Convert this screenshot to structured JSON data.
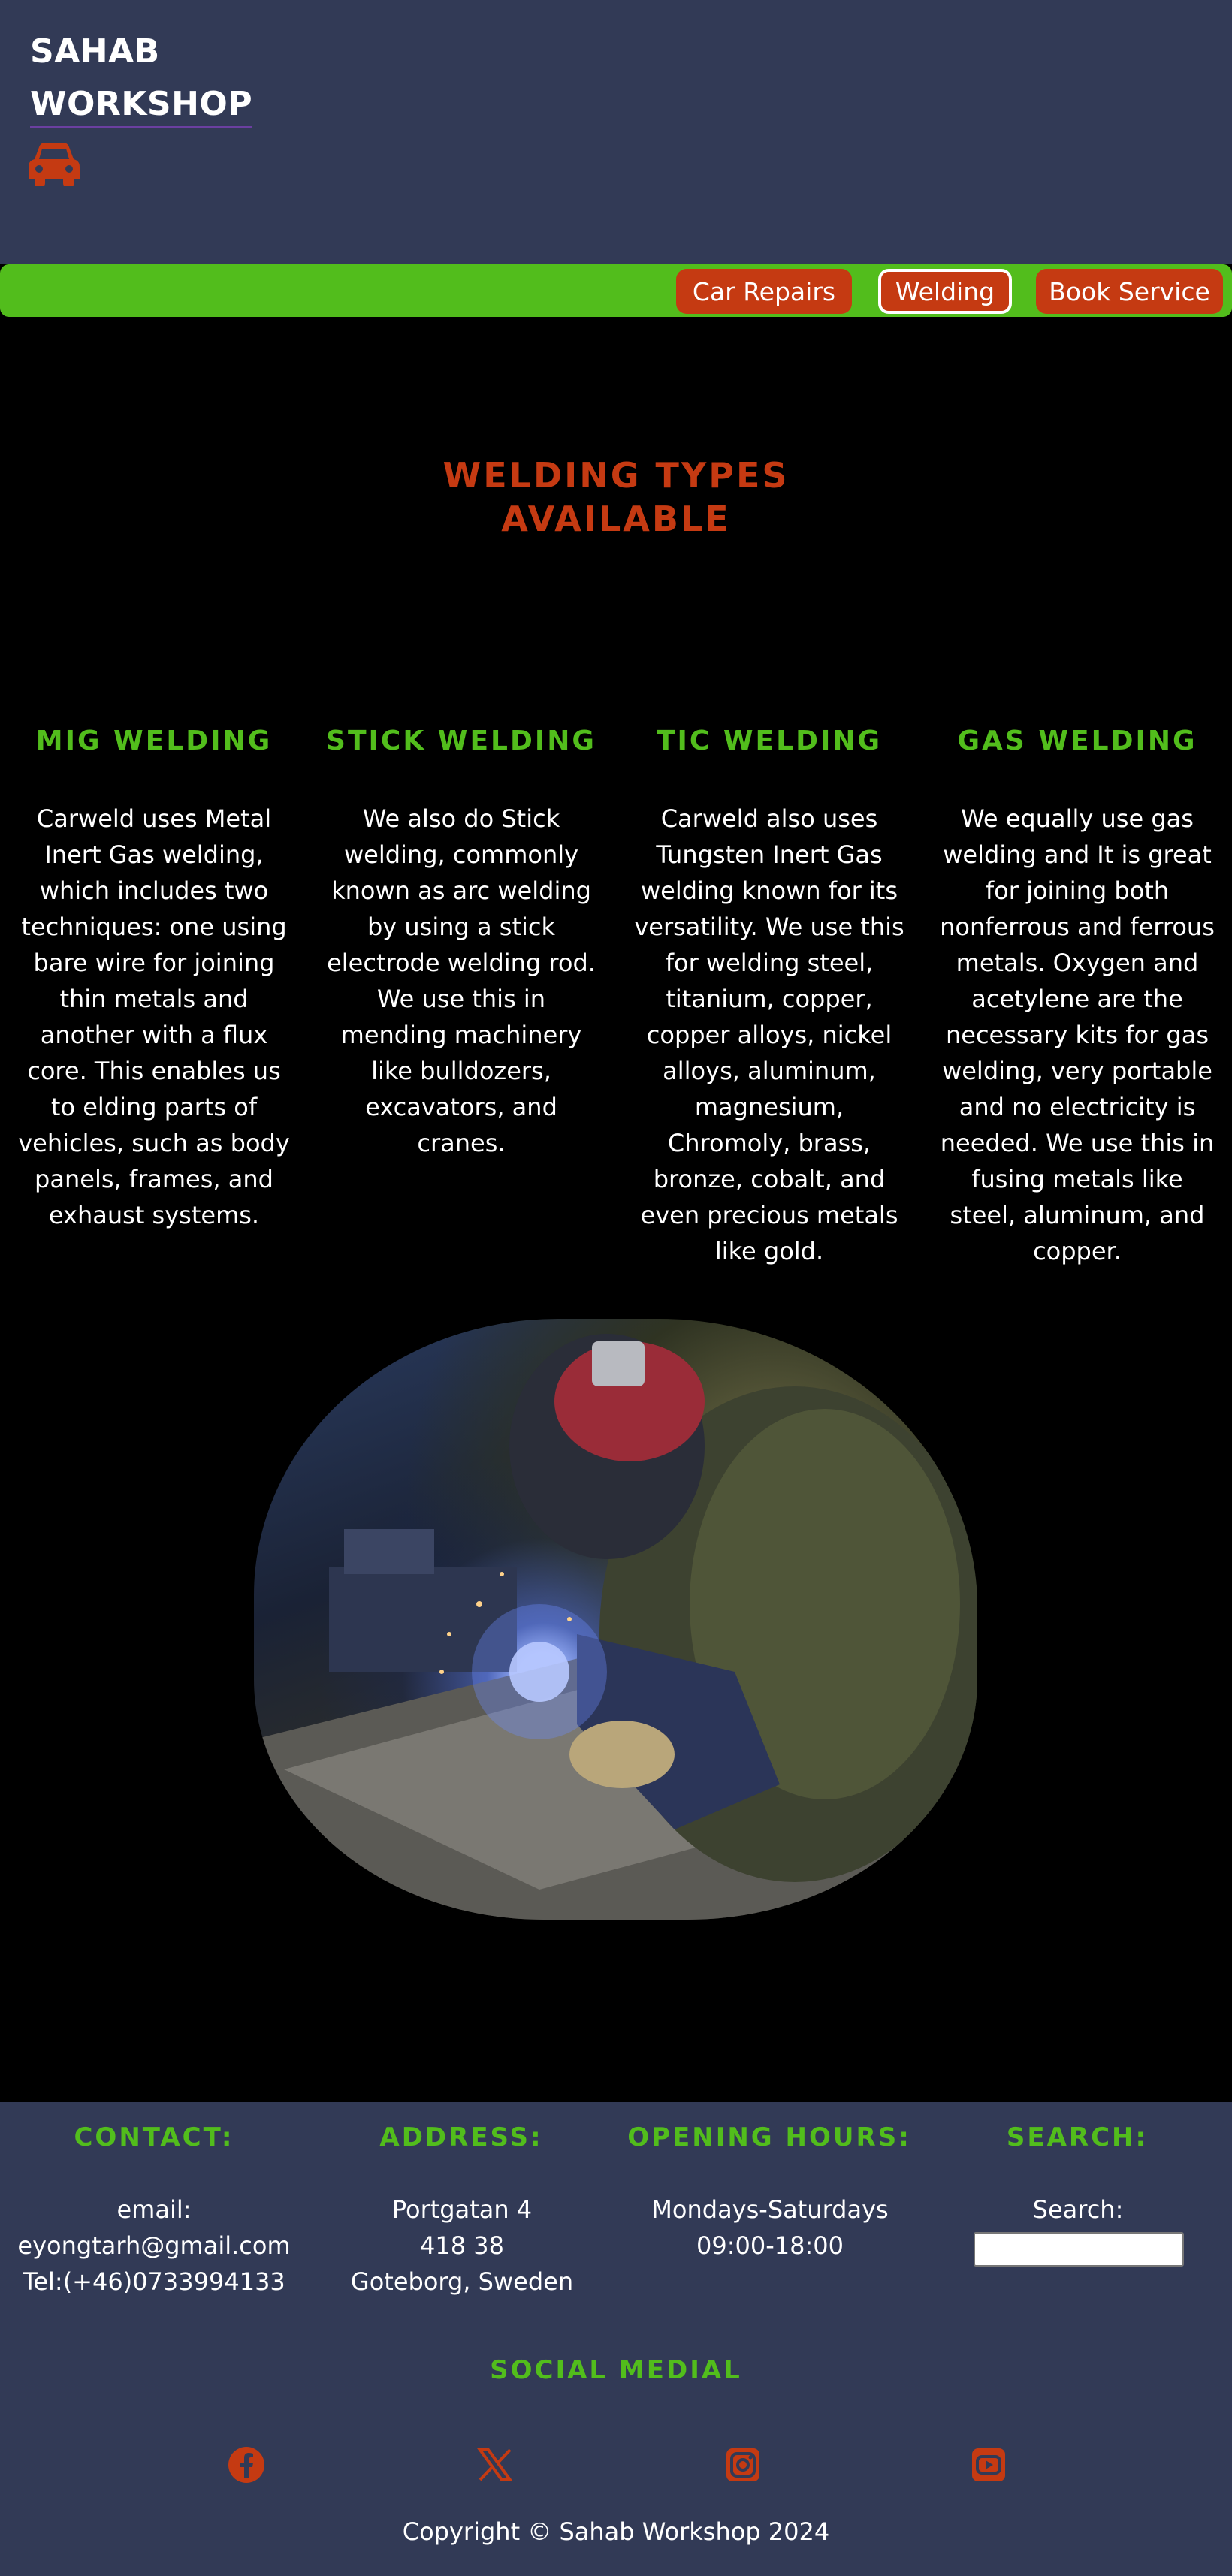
{
  "brand": {
    "line1": "SAHAB",
    "line2": "WORKSHOP",
    "icon": "car-icon"
  },
  "nav": {
    "items": [
      "Car Repairs",
      "Welding",
      "Book Service"
    ],
    "active": "Welding"
  },
  "main": {
    "title_line1": "WELDING TYPES",
    "title_line2": "AVAILABLE",
    "columns": [
      {
        "title": "MIG WELDING",
        "text": "Carweld uses Metal Inert Gas welding, which includes two techniques: one using bare wire for joining thin metals and another with a flux core. This enables us to elding parts of vehicles, such as body panels, frames, and exhaust systems."
      },
      {
        "title": "STICK WELDING",
        "text": "We also do Stick welding, commonly known as arc welding by using a stick electrode welding rod. We use this in mending machinery like bulldozers, excavators, and cranes."
      },
      {
        "title": "TIC WELDING",
        "text": "Carweld also uses Tungsten Inert Gas welding known for its versatility. We use this for welding steel, titanium, copper, copper alloys, nickel alloys, aluminum, magnesium, Chromoly, brass, bronze, cobalt, and even precious metals like gold."
      },
      {
        "title": "GAS WELDING",
        "text": "We equally use gas welding and It is great for joining both nonferrous and ferrous metals. Oxygen and acetylene are the necessary kits for gas welding, very portable and no electricity is needed. We use this in fusing metals like steel, aluminum, and copper."
      }
    ]
  },
  "footer": {
    "contact": {
      "title": "CONTACT:",
      "email_label": "email:",
      "email": "eyongtarh@gmail.com",
      "tel": "Tel:(+46)0733994133"
    },
    "address": {
      "title": "ADDRESS:",
      "street": "Portgatan 4",
      "zip": "418 38",
      "city": "Goteborg, Sweden"
    },
    "hours": {
      "title": "OPENING HOURS:",
      "days": "Mondays-Saturdays",
      "time": "09:00-18:00"
    },
    "search": {
      "title": "SEARCH:",
      "label": "Search:",
      "value": ""
    },
    "social": {
      "title": "SOCIAL MEDIAL",
      "icons": [
        "facebook-icon",
        "x-icon",
        "instagram-icon",
        "youtube-icon"
      ]
    },
    "copyright": "Copyright © Sahab Workshop 2024"
  },
  "colors": {
    "header_bg": "#323a56",
    "accent_red": "#c53a12",
    "accent_green": "#52bd1c",
    "body_bg": "#000000"
  }
}
